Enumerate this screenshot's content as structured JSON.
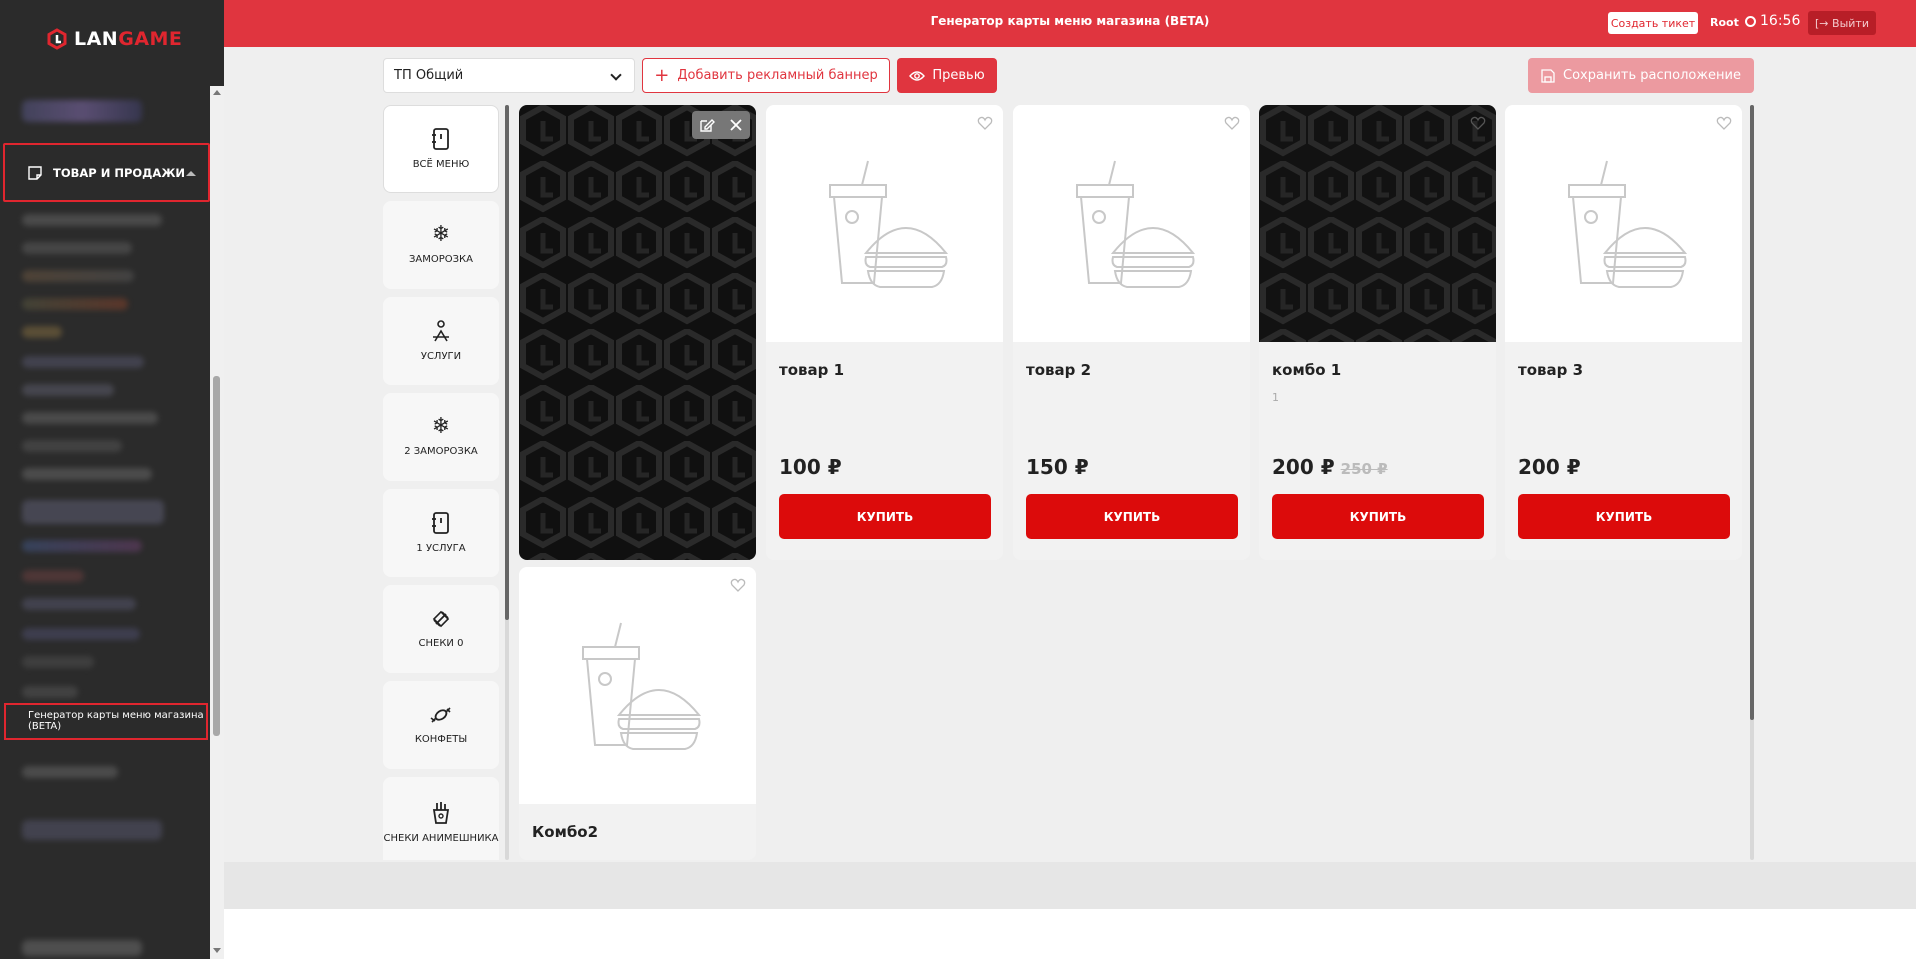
{
  "brand": {
    "logo_prefix": "LAN",
    "logo_suffix": "GAME"
  },
  "sidebar": {
    "active_section": "ТОВАР И ПРОДАЖИ",
    "active_item": "Генератор карты меню магазина (BETA)"
  },
  "header": {
    "title": "Генератор карты меню магазина (BETA)",
    "ticket_button": "Создать тикет",
    "user": "Root",
    "time": "16:56",
    "logout_button": "Выйти"
  },
  "toolbar": {
    "store_select": "ТП Общий",
    "add_banner_button": "Добавить рекламный баннер",
    "preview_button": "Превью",
    "save_button": "Сохранить расположение"
  },
  "categories": [
    {
      "label": "ВСЁ МЕНЮ",
      "icon": "notebook-icon"
    },
    {
      "label": "ЗАМОРОЗКА",
      "icon": "snowflake-icon"
    },
    {
      "label": "УСЛУГИ",
      "icon": "service-icon"
    },
    {
      "label": "2 ЗАМОРОЗКА",
      "icon": "snowflake-icon"
    },
    {
      "label": "1 УСЛУГА",
      "icon": "notebook-icon"
    },
    {
      "label": "СНЕКИ 0",
      "icon": "snack-icon"
    },
    {
      "label": "КОНФЕТЫ",
      "icon": "candy-icon"
    },
    {
      "label": "СНЕКИ АНИМЕШНИКА",
      "icon": "fries-icon"
    }
  ],
  "products": [
    {
      "name": "товар 1",
      "desc": "",
      "price": "100 ₽",
      "old_price": "",
      "buy": "КУПИТЬ"
    },
    {
      "name": "товар 2",
      "desc": "",
      "price": "150 ₽",
      "old_price": "",
      "buy": "КУПИТЬ"
    },
    {
      "name": "комбо 1",
      "desc": "1",
      "price": "200 ₽",
      "old_price": "250 ₽",
      "buy": "КУПИТЬ"
    },
    {
      "name": "товар 3",
      "desc": "",
      "price": "200 ₽",
      "old_price": "",
      "buy": "КУПИТЬ"
    },
    {
      "name": "Комбо2",
      "desc": "",
      "price": "",
      "old_price": "",
      "buy": ""
    }
  ],
  "colors": {
    "accent": "#e0353f",
    "buy": "#dc0b0b",
    "sidebar": "#2b2b2b"
  }
}
